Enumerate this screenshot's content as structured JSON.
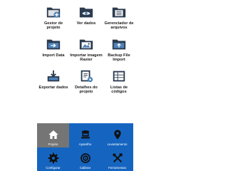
{
  "menu": {
    "items": [
      {
        "label": "Gestor de projeto",
        "icon": "folder-plus-icon"
      },
      {
        "label": "Ver dados",
        "icon": "folder-eye-icon"
      },
      {
        "label": "Gerenciador de arquivos",
        "icon": "folder-list-icon"
      },
      {
        "label": "Import Data",
        "icon": "folder-import-icon"
      },
      {
        "label": "Importar imagem Raster",
        "icon": "image-import-icon"
      },
      {
        "label": "Backup File Import",
        "icon": "folder-backup-icon"
      },
      {
        "label": "Exportar dados",
        "icon": "export-icon"
      },
      {
        "label": "Detalhes do projeto",
        "icon": "project-details-icon"
      },
      {
        "label": "Listas de códigos",
        "icon": "code-list-icon"
      }
    ]
  },
  "bottom_nav": {
    "items": [
      {
        "label": "Projeto",
        "icon": "home-icon",
        "active": true
      },
      {
        "label": "Aparelho",
        "icon": "device-icon",
        "active": false
      },
      {
        "label": "Levantamento",
        "icon": "map-pin-icon",
        "active": false
      },
      {
        "label": "Configurar",
        "icon": "gear-icon",
        "active": false
      },
      {
        "label": "Calibrar",
        "icon": "target-icon",
        "active": false
      },
      {
        "label": "Ferramentas",
        "icon": "tools-icon",
        "active": false
      }
    ]
  },
  "colors": {
    "nav_background": "#1565c0",
    "nav_active": "#757575",
    "icon_dark": "#2b3a4f",
    "icon_light": "#4f82b8"
  }
}
